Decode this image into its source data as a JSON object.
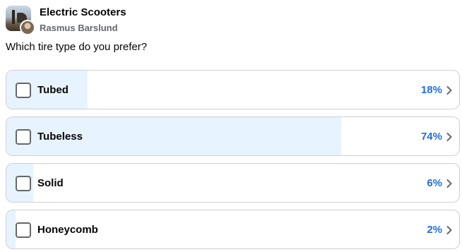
{
  "header": {
    "group_name": "Electric Scooters",
    "author_name": "Rasmus Barslund"
  },
  "poll": {
    "question": "Which tire type do you prefer?",
    "options": [
      {
        "label": "Tubed",
        "percent_text": "18%",
        "percent": 18
      },
      {
        "label": "Tubeless",
        "percent_text": "74%",
        "percent": 74
      },
      {
        "label": "Solid",
        "percent_text": "6%",
        "percent": 6
      },
      {
        "label": "Honeycomb",
        "percent_text": "2%",
        "percent": 2
      }
    ]
  },
  "icons": {
    "option_checkbox": "checkbox-icon",
    "option_arrow": "chevron-right-icon"
  },
  "colors": {
    "fill": "#e7f3ff",
    "percent": "#216fdb",
    "border": "#ced0d4"
  }
}
